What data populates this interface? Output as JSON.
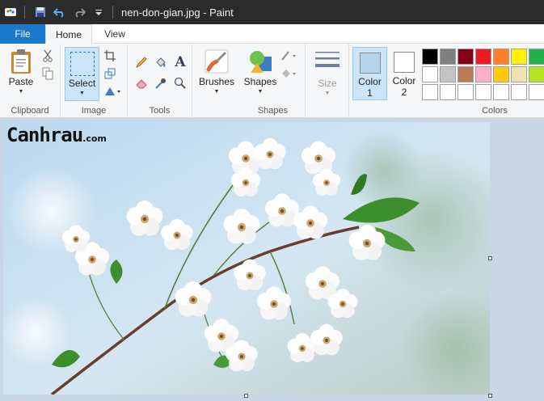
{
  "window": {
    "title": "nen-don-gian.jpg - Paint"
  },
  "tabs": {
    "file": "File",
    "home": "Home",
    "view": "View"
  },
  "ribbon": {
    "clipboard": {
      "paste": "Paste",
      "group": "Clipboard"
    },
    "image": {
      "select": "Select",
      "group": "Image"
    },
    "tools": {
      "group": "Tools"
    },
    "brushes": {
      "label": "Brushes"
    },
    "shapes": {
      "label": "Shapes",
      "group": "Shapes"
    },
    "size": {
      "label": "Size"
    },
    "colors": {
      "color1_label": "Color",
      "color1_num": "1",
      "color2_label": "Color",
      "color2_num": "2",
      "group": "Colors",
      "color1_value": "#b4d5ea",
      "color2_value": "#ffffff",
      "palette": [
        "#000000",
        "#7f7f7f",
        "#880015",
        "#ed1c24",
        "#ff7f27",
        "#fff200",
        "#22b14c",
        "#00a2e8",
        "#ffffff",
        "#c3c3c3",
        "#b97a57",
        "#ffaec9",
        "#ffc90e",
        "#efe4b0",
        "#b5e61d",
        "#99d9ea",
        "#ffffff",
        "#ffffff",
        "#ffffff",
        "#ffffff",
        "#ffffff",
        "#ffffff",
        "#ffffff",
        "#ffffff"
      ]
    }
  },
  "canvas": {
    "watermark": "Canhrau",
    "watermark_domain": ".com"
  }
}
